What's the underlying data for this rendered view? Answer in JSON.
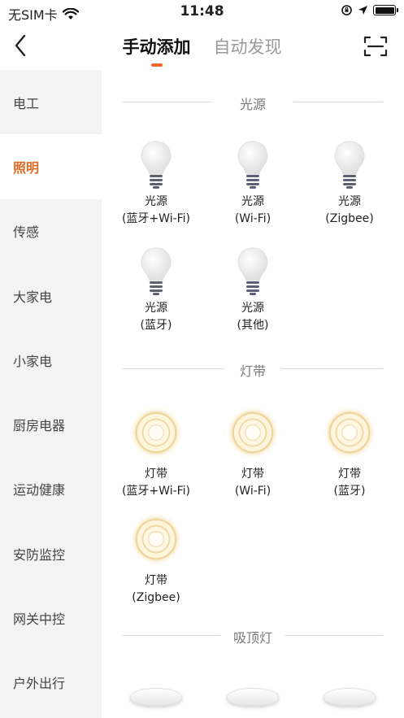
{
  "status_bar": {
    "carrier": "无SIM卡",
    "time": "11:48"
  },
  "nav": {
    "tabs": [
      {
        "label": "手动添加",
        "active": true
      },
      {
        "label": "自动发现",
        "active": false
      }
    ],
    "accent_color": "#ef6b2b"
  },
  "sidebar": {
    "items": [
      {
        "label": "电工"
      },
      {
        "label": "照明"
      },
      {
        "label": "传感"
      },
      {
        "label": "大家电"
      },
      {
        "label": "小家电"
      },
      {
        "label": "厨房电器"
      },
      {
        "label": "运动健康"
      },
      {
        "label": "安防监控"
      },
      {
        "label": "网关中控"
      },
      {
        "label": "户外出行"
      }
    ],
    "active_index": 1
  },
  "sections": [
    {
      "title": "光源",
      "icon": "light-bulb-icon",
      "items": [
        {
          "name": "光源",
          "variant": "(蓝牙+Wi-Fi)"
        },
        {
          "name": "光源",
          "variant": "(Wi-Fi)"
        },
        {
          "name": "光源",
          "variant": "(Zigbee)"
        },
        {
          "name": "光源",
          "variant": "(蓝牙)"
        },
        {
          "name": "光源",
          "variant": "(其他)"
        }
      ]
    },
    {
      "title": "灯带",
      "icon": "light-strip-icon",
      "items": [
        {
          "name": "灯带",
          "variant": "(蓝牙+Wi-Fi)"
        },
        {
          "name": "灯带",
          "variant": "(Wi-Fi)"
        },
        {
          "name": "灯带",
          "variant": "(蓝牙)"
        },
        {
          "name": "灯带",
          "variant": "(Zigbee)"
        }
      ]
    },
    {
      "title": "吸顶灯",
      "icon": "ceiling-light-icon",
      "items": []
    }
  ]
}
